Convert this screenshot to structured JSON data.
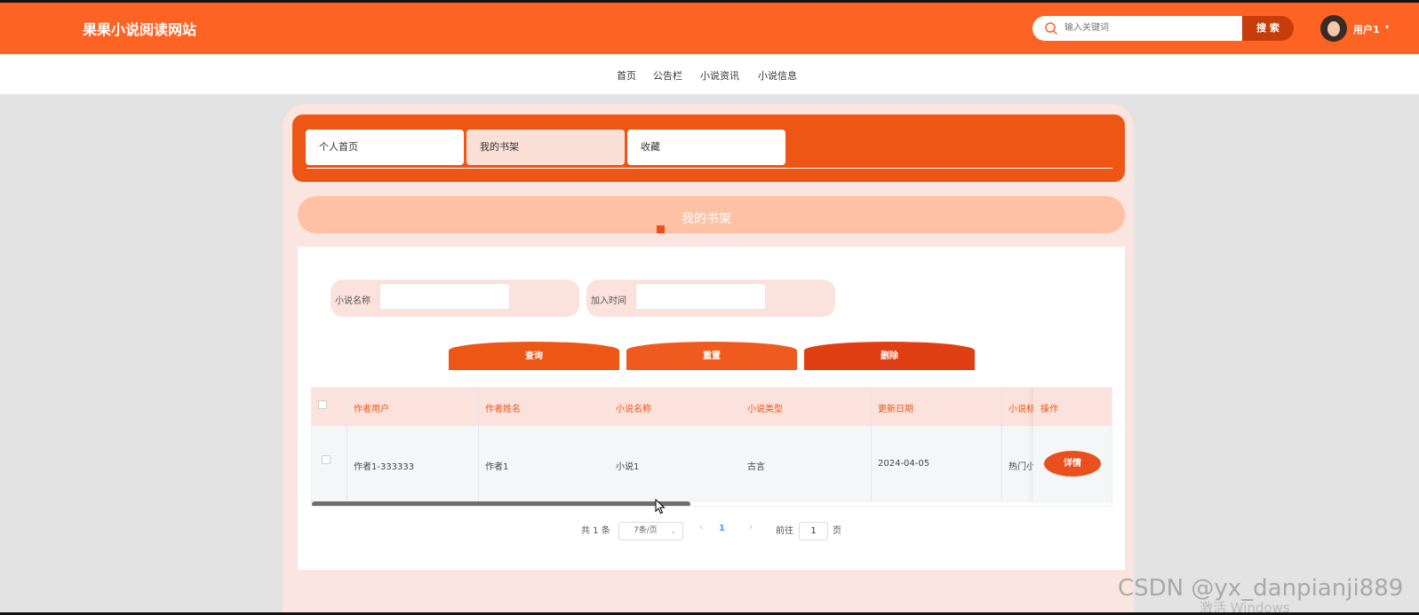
{
  "header": {
    "site_title": "果果小说阅读网站",
    "search_placeholder": "输入关键词",
    "search_button": "搜 索",
    "user_name": "用户1",
    "user_caret": "▾"
  },
  "nav": {
    "items": [
      {
        "label": "首页"
      },
      {
        "label": "公告栏"
      },
      {
        "label": "小说资讯"
      },
      {
        "label": "小说信息"
      }
    ]
  },
  "tabs": [
    {
      "label": "个人首页",
      "active": false
    },
    {
      "label": "我的书架",
      "active": true
    },
    {
      "label": "收藏",
      "active": false
    }
  ],
  "section_title": "我的书架",
  "filters": [
    {
      "label": "小说名称",
      "value": ""
    },
    {
      "label": "加入时间",
      "value": ""
    }
  ],
  "actions": {
    "query": "查询",
    "reset": "重置",
    "delete": "删除"
  },
  "table": {
    "columns": [
      "作者用户",
      "作者姓名",
      "小说名称",
      "小说类型",
      "更新日期",
      "小说标",
      "操作"
    ],
    "rows": [
      {
        "author_user": "作者1-333333",
        "author_name": "作者1",
        "novel_name": "小说1",
        "novel_type": "古言",
        "update_date": "2024-04-05",
        "novel_tag": "热门小"
      }
    ],
    "detail_button": "详情"
  },
  "pagination": {
    "total_text": "共 1 条",
    "page_size": "7条/页",
    "prev": "‹",
    "current": "1",
    "next": "›",
    "goto_label": "前往",
    "goto_value": "1",
    "page_unit": "页"
  },
  "watermark": {
    "csdn": "CSDN @yx_danpianji889",
    "windows": "激活 Windows"
  },
  "colors": {
    "header": "#fe6324",
    "tabbar": "#ed5615",
    "query_button": "#ed5615",
    "reset_button": "#ef5b1f",
    "delete_button": "#e03e13",
    "accent_text": "#e9581a"
  }
}
